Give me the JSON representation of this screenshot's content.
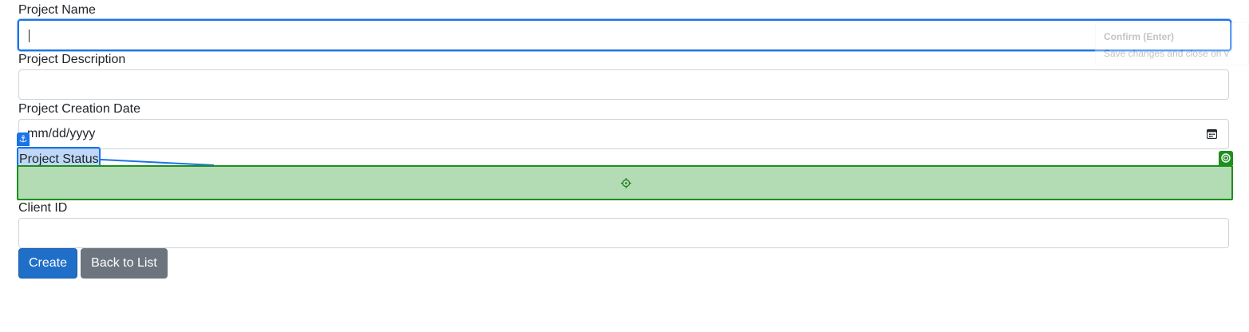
{
  "form": {
    "project_name": {
      "label": "Project Name",
      "value": ""
    },
    "project_description": {
      "label": "Project Description",
      "value": ""
    },
    "project_creation_date": {
      "label": "Project Creation Date",
      "placeholder": "mm/dd/yyyy"
    },
    "project_status": {
      "label": "Project Status",
      "value": ""
    },
    "client_id": {
      "label": "Client ID",
      "value": ""
    }
  },
  "buttons": {
    "create_label": "Create",
    "back_label": "Back to List"
  },
  "tooltip": {
    "title": "Confirm (Enter)",
    "description": "Save changes and close on v"
  },
  "overlay": {
    "anchor_glyph": "⚓",
    "anchor_color": "#1a73e8",
    "drop_target_color": "#1e8e1e",
    "drop_fill_color": "#b4dcb4"
  },
  "icons": [
    "calendar-icon",
    "anchor-icon",
    "target-icon",
    "crosshair-icon"
  ]
}
